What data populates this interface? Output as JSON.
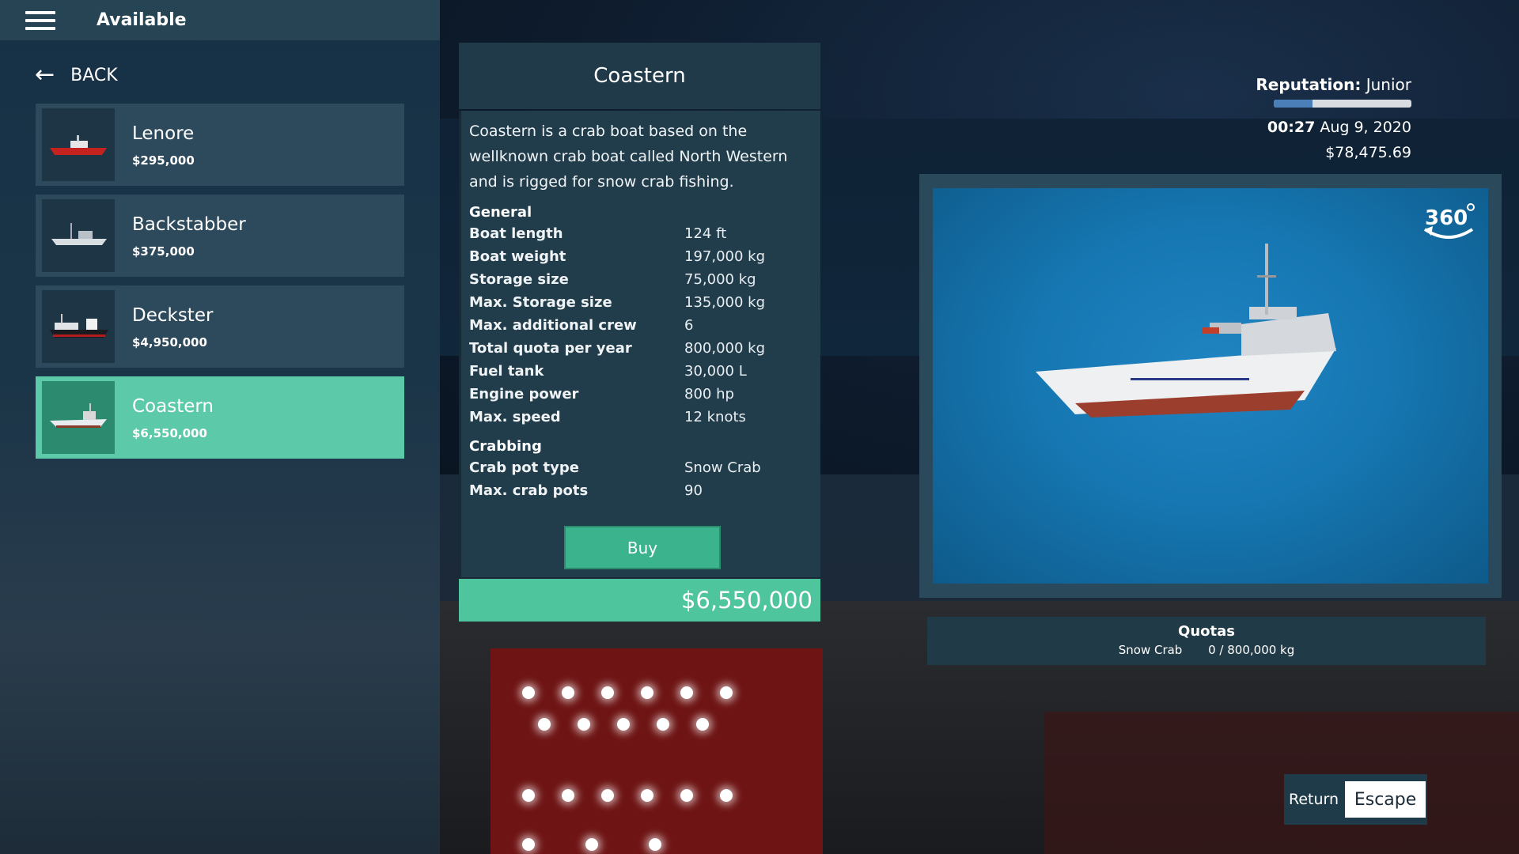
{
  "topbar": {
    "title": "Available"
  },
  "nav": {
    "back_label": "BACK"
  },
  "boats": [
    {
      "name": "Lenore",
      "price": "$295,000",
      "hull_color": "#c4221e"
    },
    {
      "name": "Backstabber",
      "price": "$375,000",
      "hull_color": "#d8dde2"
    },
    {
      "name": "Deckster",
      "price": "$4,950,000",
      "hull_color": "#1a1c22"
    },
    {
      "name": "Coastern",
      "price": "$6,550,000",
      "hull_color": "#e9ecef"
    }
  ],
  "selected_boat": "Coastern",
  "detail": {
    "title": "Coastern",
    "description": "Coastern is a crab boat based on the wellknown crab boat called North Western and is rigged for snow crab fishing.",
    "general_heading": "General",
    "general": [
      {
        "key": "Boat length",
        "value": "124 ft"
      },
      {
        "key": "Boat weight",
        "value": "197,000 kg"
      },
      {
        "key": "Storage size",
        "value": "75,000 kg"
      },
      {
        "key": "Max. Storage size",
        "value": "135,000 kg"
      },
      {
        "key": "Max. additional crew",
        "value": "6"
      },
      {
        "key": "Total quota per year",
        "value": "800,000 kg"
      },
      {
        "key": "Fuel tank",
        "value": "30,000 L"
      },
      {
        "key": "Engine power",
        "value": "800 hp"
      },
      {
        "key": "Max. speed",
        "value": "12 knots"
      }
    ],
    "crabbing_heading": "Crabbing",
    "crabbing": [
      {
        "key": "Crab pot type",
        "value": "Snow Crab"
      },
      {
        "key": "Max. crab pots",
        "value": "90"
      }
    ],
    "buy_label": "Buy",
    "price": "$6,550,000"
  },
  "status": {
    "reputation_label": "Reputation:",
    "reputation_value": "Junior",
    "reputation_progress": 0.28,
    "time": "00:27",
    "date": "Aug 9, 2020",
    "money": "$78,475.69"
  },
  "viewer": {
    "rotate_label": "360",
    "bg_color": "#1677b2"
  },
  "quotas": {
    "title": "Quotas",
    "species": "Snow Crab",
    "amount": "0 / 800,000 kg"
  },
  "return_hint": {
    "label": "Return",
    "key": "Escape"
  },
  "colors": {
    "accent": "#4ec59c",
    "panel": "#213d4b",
    "buy": "#3bb48e"
  }
}
